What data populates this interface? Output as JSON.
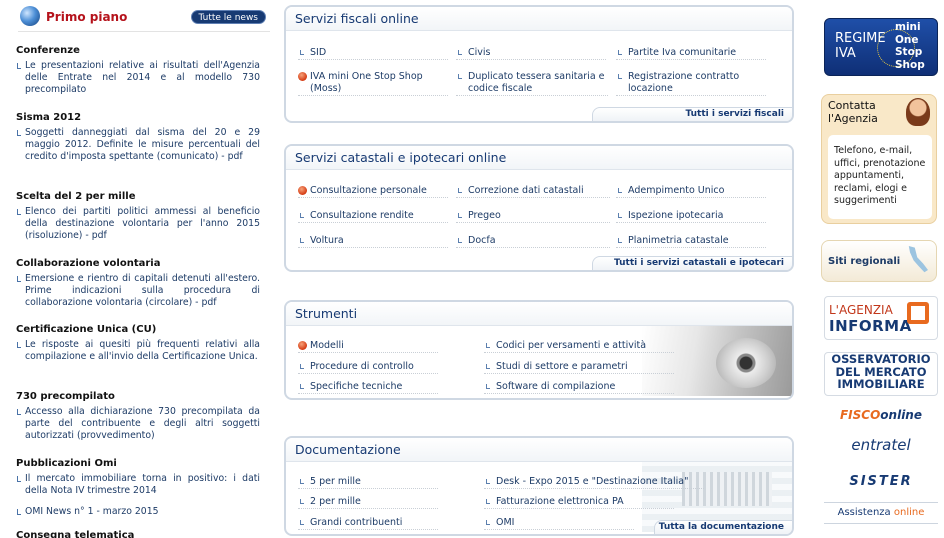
{
  "primo_piano": {
    "title": "Primo piano",
    "all_news": "Tutte le news",
    "news": [
      {
        "heading": "Conferenze",
        "text": "Le presentazioni relative ai risultati dell'Agenzia delle Entrate nel 2014 e al modello 730 precompilato"
      },
      {
        "heading": "Sisma 2012",
        "text": "Soggetti danneggiati dal sisma del 20 e 29 maggio 2012. Definite le misure percentuali del credito d'imposta spettante (comunicato) - pdf"
      },
      {
        "heading": "Scelta del 2 per mille",
        "text": "Elenco dei partiti politici ammessi al beneficio della destinazione volontaria per l'anno 2015 (risoluzione) - pdf"
      },
      {
        "heading": "Collaborazione volontaria",
        "text": "Emersione e rientro di capitali detenuti all'estero. Prime indicazioni sulla procedura di collaborazione volontaria (circolare) - pdf"
      },
      {
        "heading": "Certificazione Unica (CU)",
        "text": "Le risposte ai quesiti più frequenti relativi alla compilazione e all'invio della Certificazione Unica."
      },
      {
        "heading": "730 precompilato",
        "text": "Accesso alla dichiarazione 730 precompilata da parte del contribuente e degli altri soggetti autorizzati (provvedimento)"
      },
      {
        "heading": "Pubblicazioni Omi",
        "text": "Il mercato immobiliare torna in positivo: i dati della Nota IV trimestre 2014"
      },
      {
        "heading": "",
        "text": "OMI News n° 1 - marzo 2015"
      },
      {
        "heading": "Consegna telematica",
        "text": ""
      }
    ]
  },
  "boxes": [
    {
      "title": "Servizi fiscali online",
      "link": "Tutti i servizi fiscali",
      "items": [
        "SID",
        "Civis",
        "Partite Iva comunitarie",
        "IVA mini One Stop Shop (Moss)",
        "Duplicato tessera sanitaria e codice fiscale",
        "Registrazione contratto locazione"
      ]
    },
    {
      "title": "Servizi catastali e ipotecari online",
      "link": "Tutti i servizi catastali e ipotecari",
      "items": [
        "Consultazione personale",
        "Correzione dati catastali",
        "Adempimento Unico",
        "Consultazione rendite",
        "Pregeo",
        "Ispezione ipotecaria",
        "Voltura",
        "Docfa",
        "Planimetria catastale"
      ]
    },
    {
      "title": "Strumenti",
      "link": "",
      "items": [
        "Modelli",
        "Codici per versamenti e attività",
        "Procedure di controllo",
        "Studi di settore e parametri",
        "Specifiche tecniche",
        "Software di compilazione"
      ]
    },
    {
      "title": "Documentazione",
      "link": "Tutta la documentazione",
      "items": [
        "5 per mille",
        "Desk - Expo 2015 e \"Destinazione Italia\"",
        "2 per mille",
        "Fatturazione elettronica PA",
        "Grandi contribuenti",
        "OMI"
      ]
    }
  ],
  "sidebar": {
    "regime_a": "REGIME\nIVA",
    "regime_b": "mini\nOne\nStop\nShop",
    "contact_title": "Contatta\nl'Agenzia",
    "contact_body": "Telefono, e-mail, uffici, prenotazione appuntamenti, reclami, elogi e suggerimenti",
    "siti": "Siti regionali",
    "informa_a": "L'AGENZIA",
    "informa_b": "INFORMA",
    "osserv": [
      "OSSERVATORIO",
      "DEL MERCATO",
      "IMMOBILIARE"
    ],
    "fisco_a": "FISCO",
    "fisco_b": "online",
    "entratel": "entratel",
    "sister": "SISTER",
    "assist_a": "Assistenza",
    "assist_b": "online"
  }
}
